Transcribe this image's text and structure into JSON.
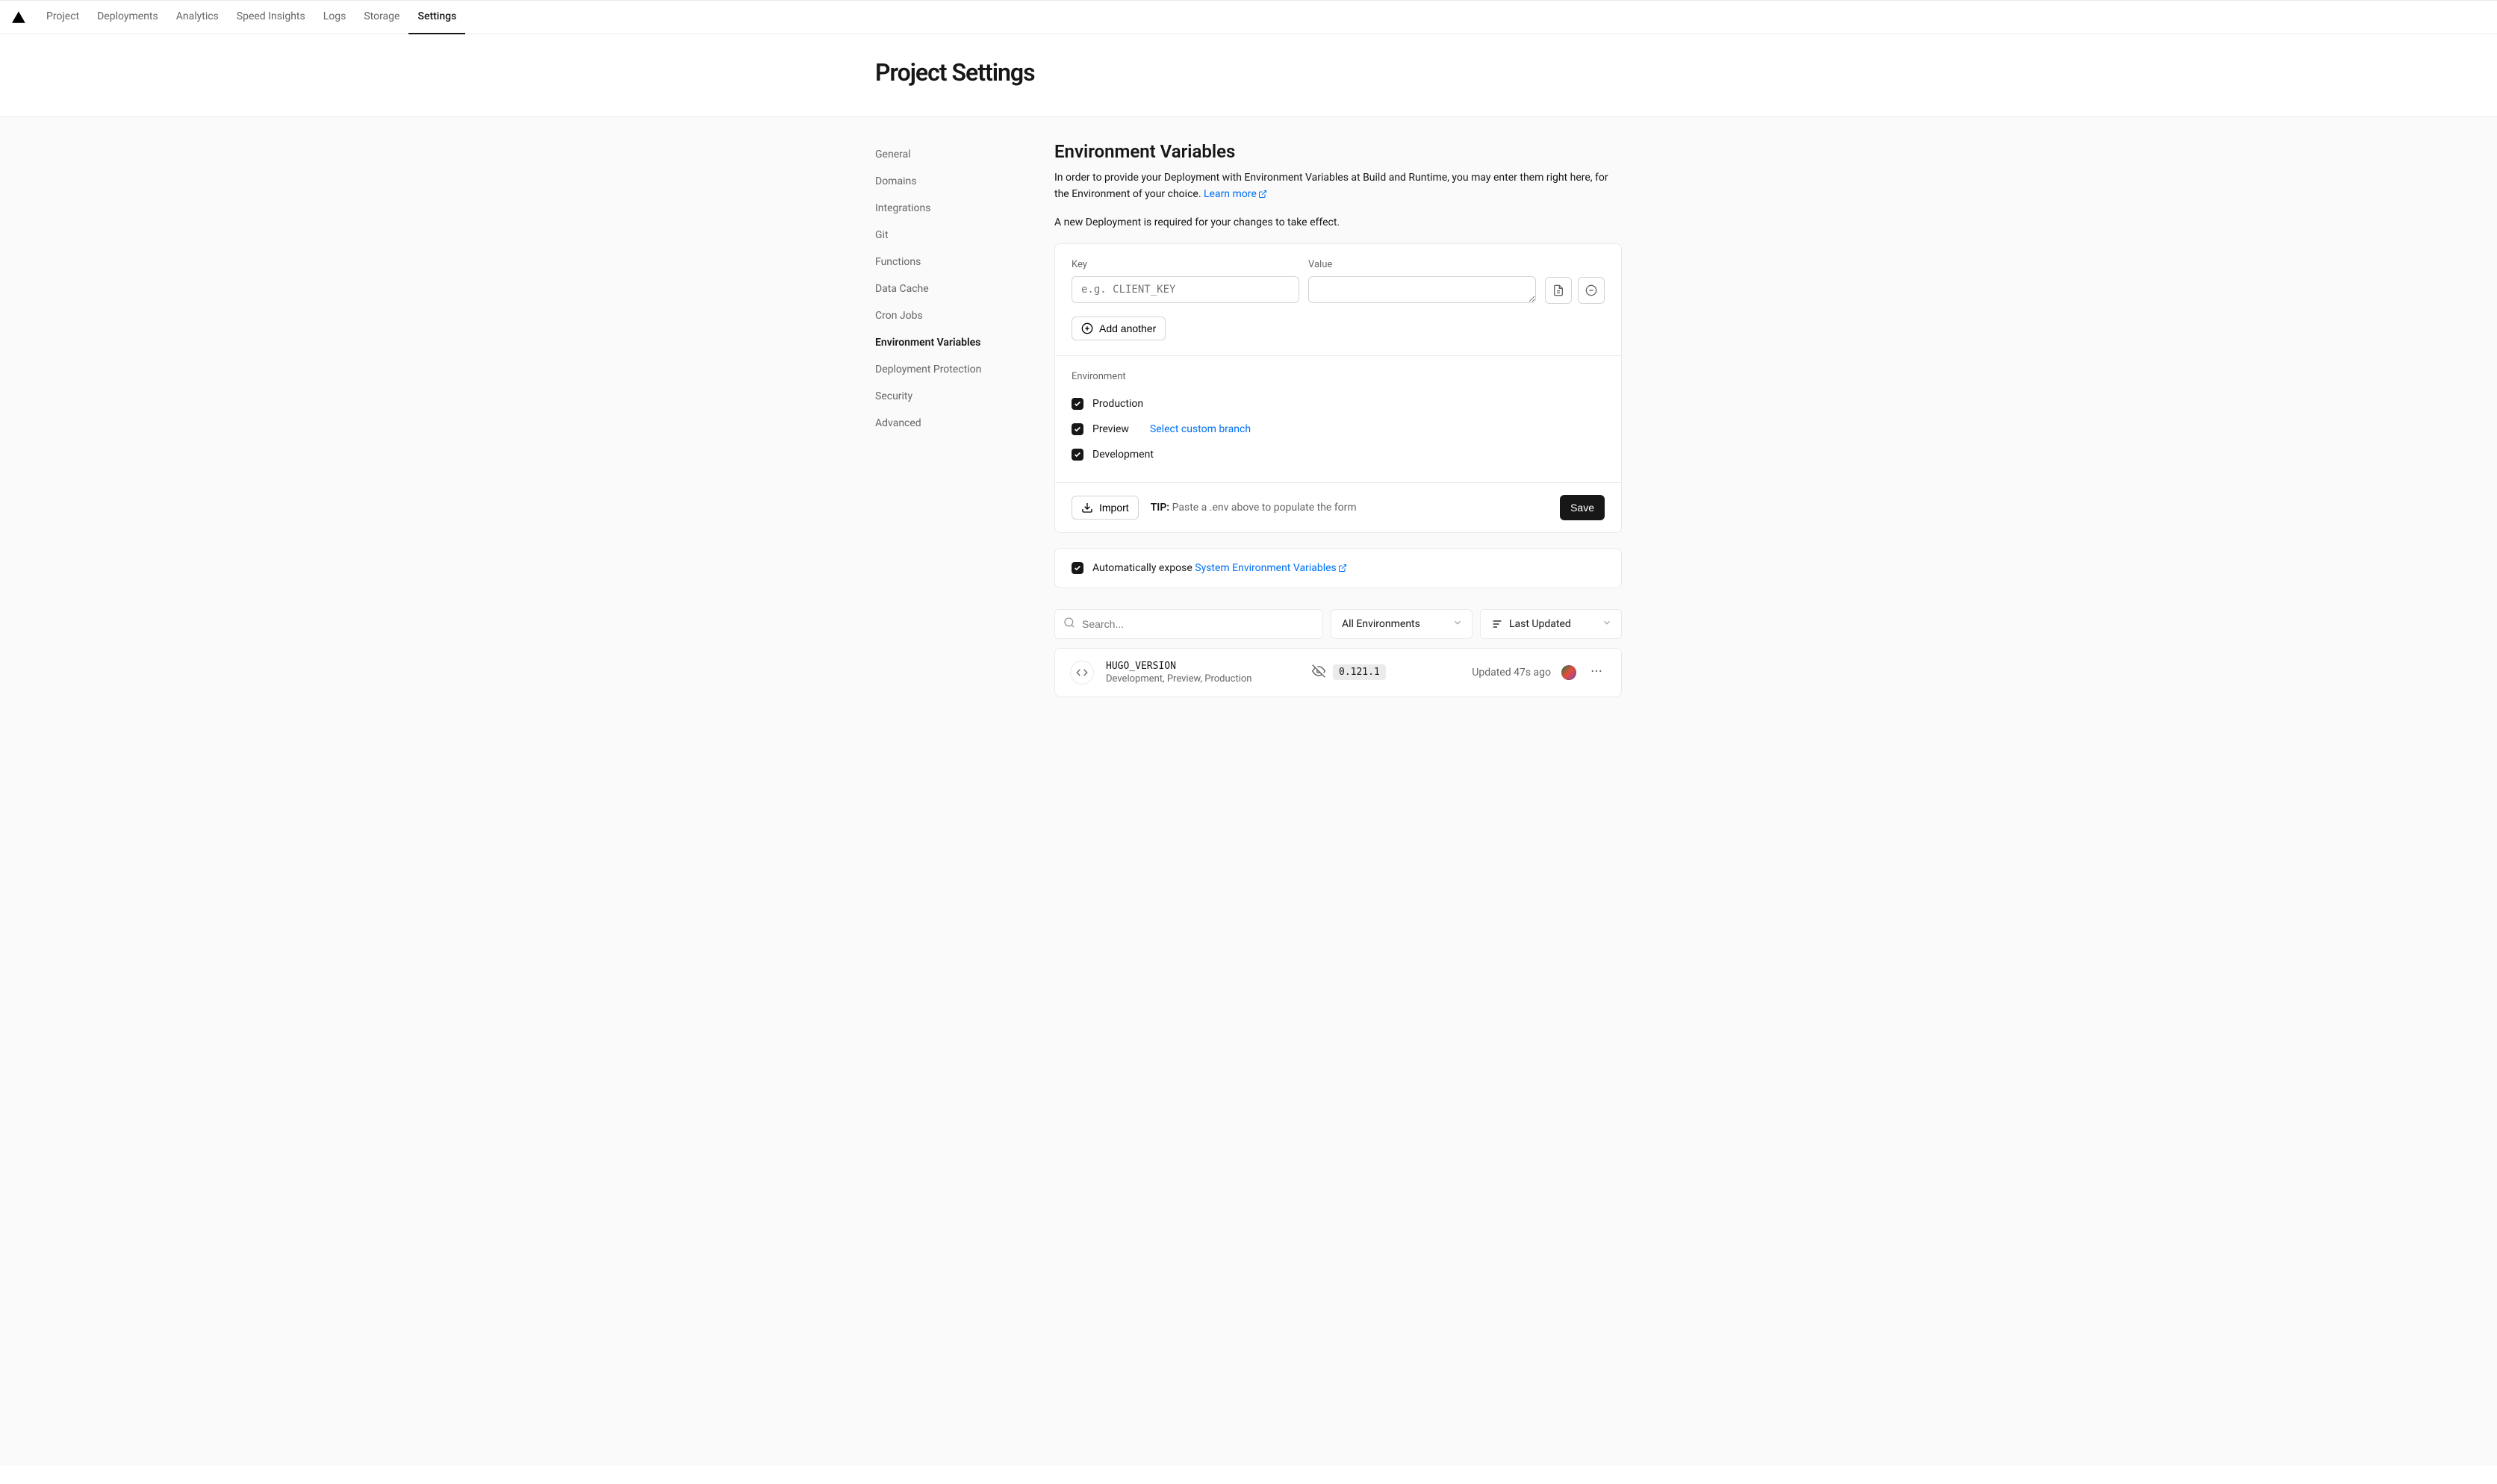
{
  "nav": {
    "tabs": [
      "Project",
      "Deployments",
      "Analytics",
      "Speed Insights",
      "Logs",
      "Storage",
      "Settings"
    ],
    "active": "Settings"
  },
  "page_title": "Project Settings",
  "sidebar": {
    "items": [
      "General",
      "Domains",
      "Integrations",
      "Git",
      "Functions",
      "Data Cache",
      "Cron Jobs",
      "Environment Variables",
      "Deployment Protection",
      "Security",
      "Advanced"
    ],
    "active": "Environment Variables"
  },
  "env_section": {
    "title": "Environment Variables",
    "desc_pre": "In order to provide your Deployment with Environment Variables at Build and Runtime, you may enter them right here, for the Environment of your choice. ",
    "learn_more": "Learn more",
    "note": "A new Deployment is required for your changes to take effect.",
    "key_label": "Key",
    "value_label": "Value",
    "key_placeholder": "e.g. CLIENT_KEY",
    "add_another": "Add another",
    "environment_label": "Environment",
    "env_production": "Production",
    "env_preview": "Preview",
    "env_development": "Development",
    "select_branch": "Select custom branch",
    "import": "Import",
    "tip_label": "TIP:",
    "tip_text": " Paste a .env above to populate the form",
    "save": "Save"
  },
  "expose": {
    "label_pre": "Automatically expose ",
    "link": "System Environment Variables"
  },
  "filters": {
    "search_placeholder": "Search...",
    "env_filter": "All Environments",
    "sort_label": "Last Updated"
  },
  "variables": [
    {
      "name": "HUGO_VERSION",
      "envs": "Development, Preview, Production",
      "value": "0.121.1",
      "updated": "Updated 47s ago"
    }
  ]
}
